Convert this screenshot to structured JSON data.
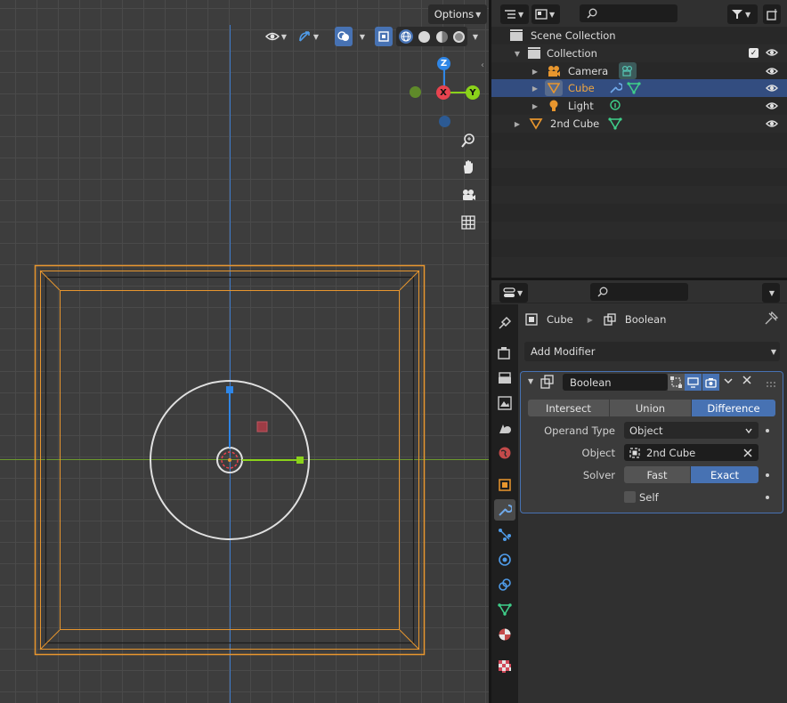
{
  "viewport": {
    "options_label": "Options",
    "gizmo": {
      "z": "Z",
      "x": "X",
      "y": "Y"
    },
    "nav_icons": [
      "zoom-icon",
      "hand-pan-icon",
      "camera-icon",
      "grid-icon"
    ]
  },
  "outliner": {
    "root": "Scene Collection",
    "items": [
      {
        "label": "Collection",
        "type": "collection"
      },
      {
        "label": "Camera",
        "type": "camera"
      },
      {
        "label": "Cube",
        "type": "mesh",
        "selected": true
      },
      {
        "label": "Light",
        "type": "light"
      },
      {
        "label": "2nd Cube",
        "type": "mesh"
      }
    ]
  },
  "properties": {
    "breadcrumb_object": "Cube",
    "breadcrumb_modifier": "Boolean",
    "add_modifier_label": "Add Modifier",
    "modifier": {
      "name": "Boolean",
      "operations": [
        "Intersect",
        "Union",
        "Difference"
      ],
      "active_operation": "Difference",
      "operand_type_label": "Operand Type",
      "operand_type_value": "Object",
      "object_label": "Object",
      "object_value": "2nd Cube",
      "solver_label": "Solver",
      "solvers": [
        "Fast",
        "Exact"
      ],
      "active_solver": "Exact",
      "self_label": "Self"
    }
  },
  "colors": {
    "accent": "#4772b3",
    "selection_outline": "#e8962e",
    "axis_x": "#e8434f",
    "axis_y": "#8ad21a",
    "axis_z": "#2f86e6"
  }
}
